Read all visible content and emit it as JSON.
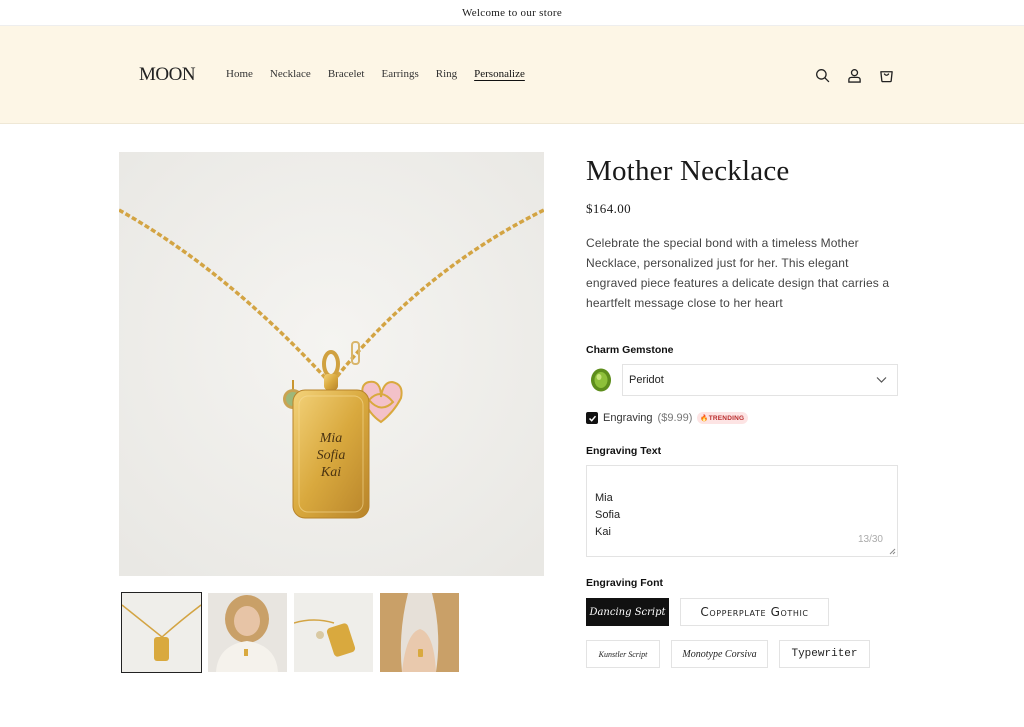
{
  "announcement": "Welcome to our store",
  "logo": "MOON",
  "nav": [
    "Home",
    "Necklace",
    "Bracelet",
    "Earrings",
    "Ring",
    "Personalize"
  ],
  "nav_active": "Personalize",
  "header_icons": [
    "search-icon",
    "account-icon",
    "cart-icon"
  ],
  "product": {
    "title": "Mother Necklace",
    "price": "$164.00",
    "description": "Celebrate the special bond with a timeless Mother Necklace, personalized just for her. This elegant engraved piece features a delicate design that carries a heartfelt message close to her heart"
  },
  "gallery": {
    "main_engraving": [
      "Mia",
      "Sofia",
      "Kai"
    ],
    "thumbnail_count": 4,
    "selected_thumbnail": 1
  },
  "options": {
    "gemstone_label": "Charm Gemstone",
    "gemstone_value": "Peridot",
    "gemstone_color": "#7cae2a",
    "engraving_checkbox_label": "Engraving",
    "engraving_price": "($9.99)",
    "engraving_checked": true,
    "trending_badge": "TRENDING",
    "engraving_text_label": "Engraving Text",
    "engraving_text_value": "Mia\nSofia\nKai",
    "char_counter": "13/30",
    "font_label": "Engraving Font",
    "fonts": [
      "Dancing Script",
      "Copperplate Gothic",
      "Kunstler Script",
      "Monotype Corsiva",
      "Typewriter"
    ],
    "selected_font": "Dancing Script"
  },
  "colors": {
    "header_bg": "#fdf6e6",
    "accent": "#111111",
    "gold": "#d9a93e",
    "trending_red": "#b92b2b"
  }
}
